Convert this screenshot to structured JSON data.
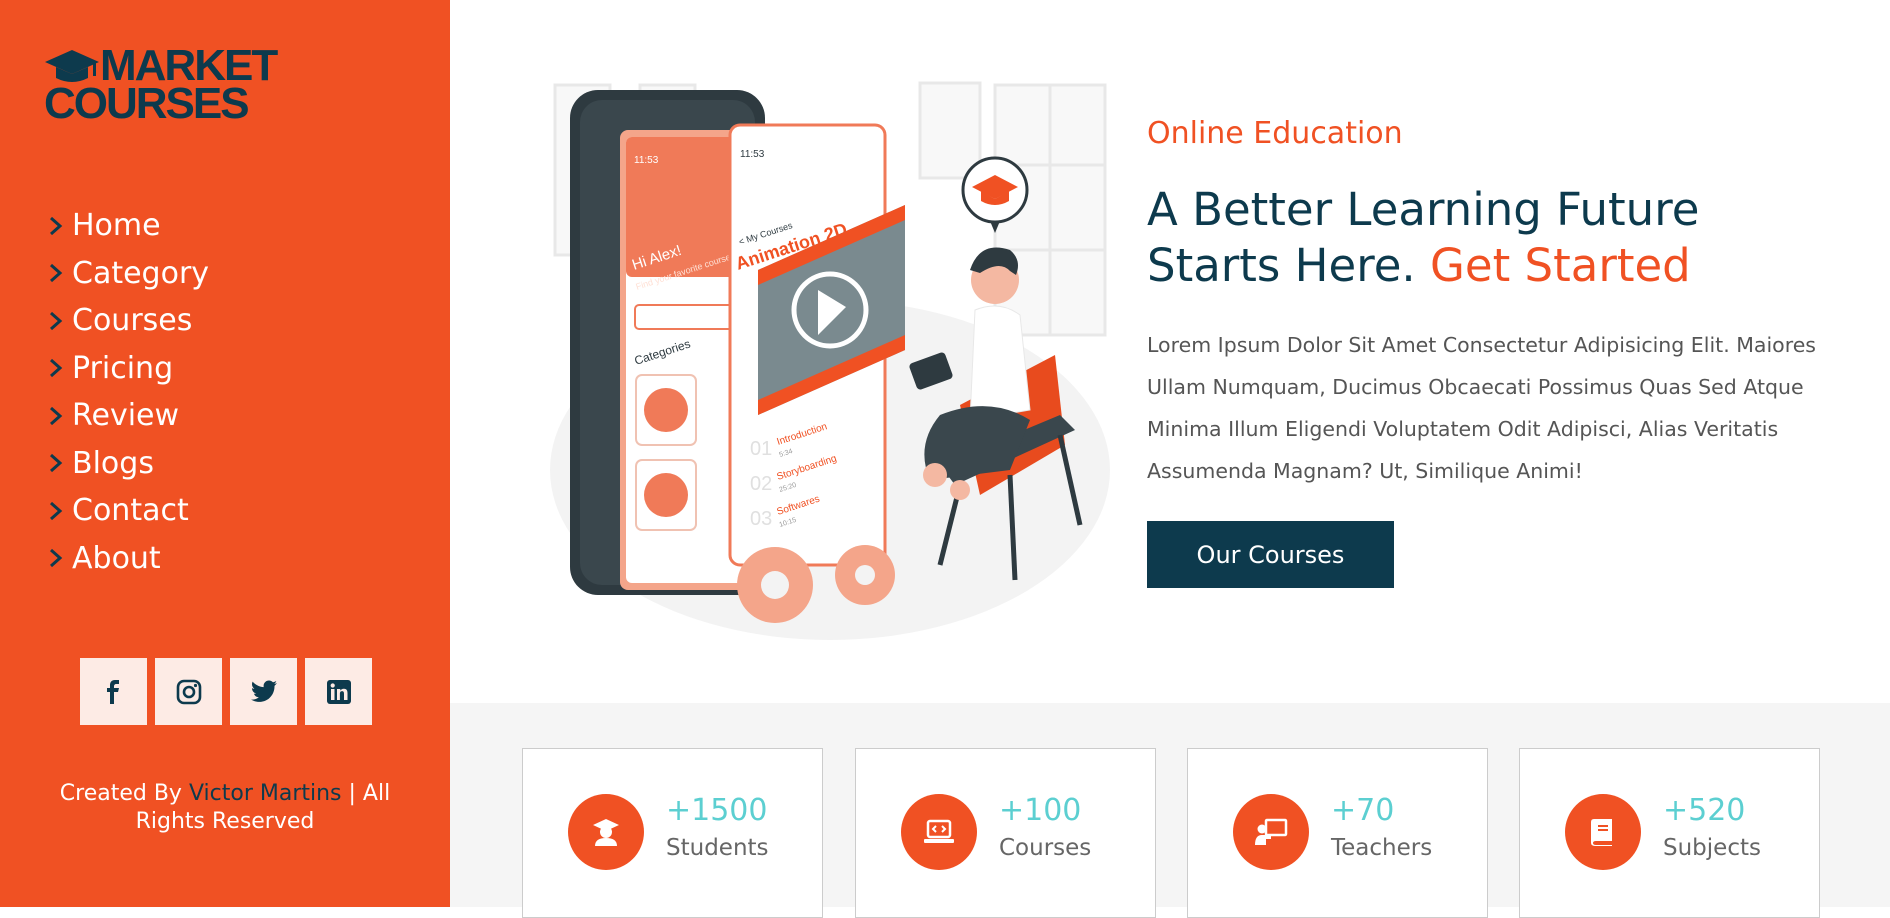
{
  "brand": {
    "line1": "MARKET",
    "line2": "COURSES"
  },
  "nav": {
    "items": [
      {
        "label": "Home"
      },
      {
        "label": "Category"
      },
      {
        "label": "Courses"
      },
      {
        "label": "Pricing"
      },
      {
        "label": "Review"
      },
      {
        "label": "Blogs"
      },
      {
        "label": "Contact"
      },
      {
        "label": "About"
      }
    ]
  },
  "social": [
    "facebook-icon",
    "instagram-icon",
    "twitter-icon",
    "linkedin-icon"
  ],
  "credit": {
    "prefix": "Created By ",
    "author": "Victor Martins",
    "suffix": " | All Rights Reserved"
  },
  "hero": {
    "eyebrow": "Online Education",
    "headline_main": "A Better Learning Future Starts Here.",
    "headline_accent": "Get Started",
    "description": "Lorem Ipsum Dolor Sit Amet Consectetur Adipisicing Elit. Maiores Ullam Numquam, Ducimus Obcaecati Possimus Quas Sed Atque Minima Illum Eligendi Voluptatem Odit Adipisci, Alias Veritatis Assumenda Magnam? Ut, Similique Animi!",
    "cta_label": "Our Courses",
    "illustration": {
      "greeting": "Hi Alex!",
      "search_hint": "Find your favorite course",
      "categories": "Categories",
      "time1": "11:53",
      "time2": "11:53",
      "my_courses": "< My Courses",
      "course_title": "Animation 2D",
      "lessons": [
        {
          "num": "01",
          "title": "Introduction",
          "time": "5:34"
        },
        {
          "num": "02",
          "title": "Storyboarding",
          "time": "25:20"
        },
        {
          "num": "03",
          "title": "Softwares",
          "time": "10:15"
        }
      ]
    }
  },
  "stats": [
    {
      "value": "+1500",
      "label": "Students",
      "icon": "graduate-icon"
    },
    {
      "value": "+100",
      "label": "Courses",
      "icon": "laptop-code-icon"
    },
    {
      "value": "+70",
      "label": "Teachers",
      "icon": "chalkboard-teacher-icon"
    },
    {
      "value": "+520",
      "label": "Subjects",
      "icon": "book-icon"
    }
  ],
  "colors": {
    "accent": "#f05123",
    "dark": "#0d3a4d",
    "teal": "#5ccfd1",
    "band": "#f5f5f5"
  }
}
